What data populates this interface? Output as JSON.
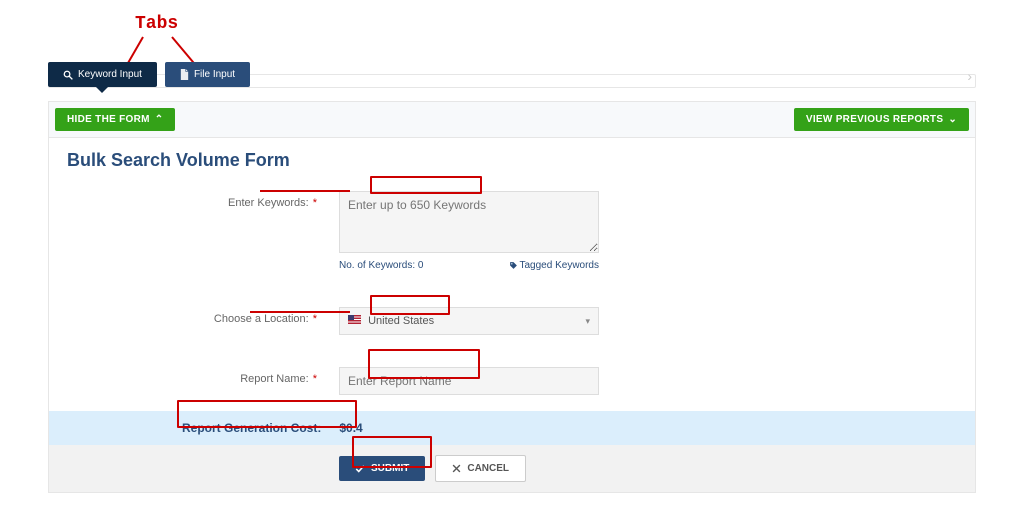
{
  "annot": {
    "tabs_label": "Tabs"
  },
  "tabs": {
    "keyword": "Keyword Input",
    "file": "File Input"
  },
  "bar": {
    "hide": "HIDE THE FORM",
    "previous": "VIEW PREVIOUS REPORTS"
  },
  "panel": {
    "title": "Bulk Search Volume Form"
  },
  "form": {
    "keywords_label": "Enter Keywords:",
    "keywords_ph": "Enter up to 650 Keywords",
    "keywords_countlabel": "No. of Keywords: 0",
    "tagged_link": "Tagged Keywords",
    "location_label": "Choose a Location:",
    "location_value": "United States",
    "report_label": "Report Name:",
    "report_ph": "Enter Report Name",
    "cost_label": "Report Generation Cost:",
    "cost_value": "$0.4",
    "submit": "SUBMIT",
    "cancel": "CANCEL"
  }
}
